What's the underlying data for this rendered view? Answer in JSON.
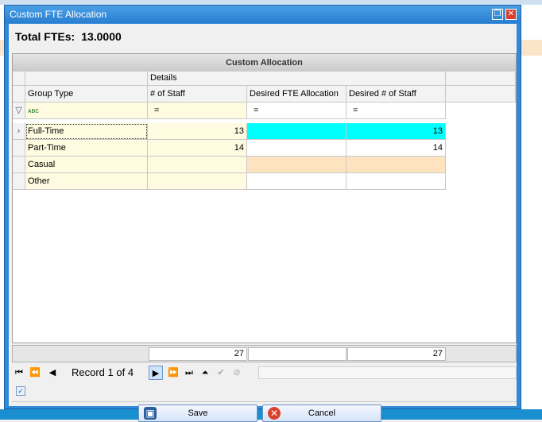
{
  "window": {
    "title": "Custom FTE Allocation",
    "restore_icon": "restore-icon",
    "close_icon": "close-icon"
  },
  "total": {
    "label": "Total FTEs:",
    "value": "13.0000"
  },
  "grid": {
    "band_title": "Custom Allocation",
    "band_details": "Details",
    "columns": [
      "Group Type",
      "# of Staff",
      "Desired FTE Allocation",
      "Desired # of Staff"
    ],
    "filter": {
      "group_type": "ᴀʙᴄ",
      "staff": "=",
      "fte": "=",
      "desired": "="
    },
    "rows": [
      {
        "group": "Full-Time",
        "staff": "13",
        "fte": "",
        "desired": "13"
      },
      {
        "group": "Part-Time",
        "staff": "14",
        "fte": "",
        "desired": "14"
      },
      {
        "group": "Casual",
        "staff": "",
        "fte": "",
        "desired": ""
      },
      {
        "group": "Other",
        "staff": "",
        "fte": "",
        "desired": ""
      }
    ],
    "totals": {
      "staff": "27",
      "fte": "",
      "desired": "27"
    }
  },
  "navigator": {
    "record_text": "Record 1 of 4"
  },
  "buttons": {
    "save": "Save",
    "cancel": "Cancel"
  },
  "colors": {
    "highlight": "#00ffff",
    "casual_row": "#fde3c0",
    "title_bar": "#2f8ad8"
  }
}
